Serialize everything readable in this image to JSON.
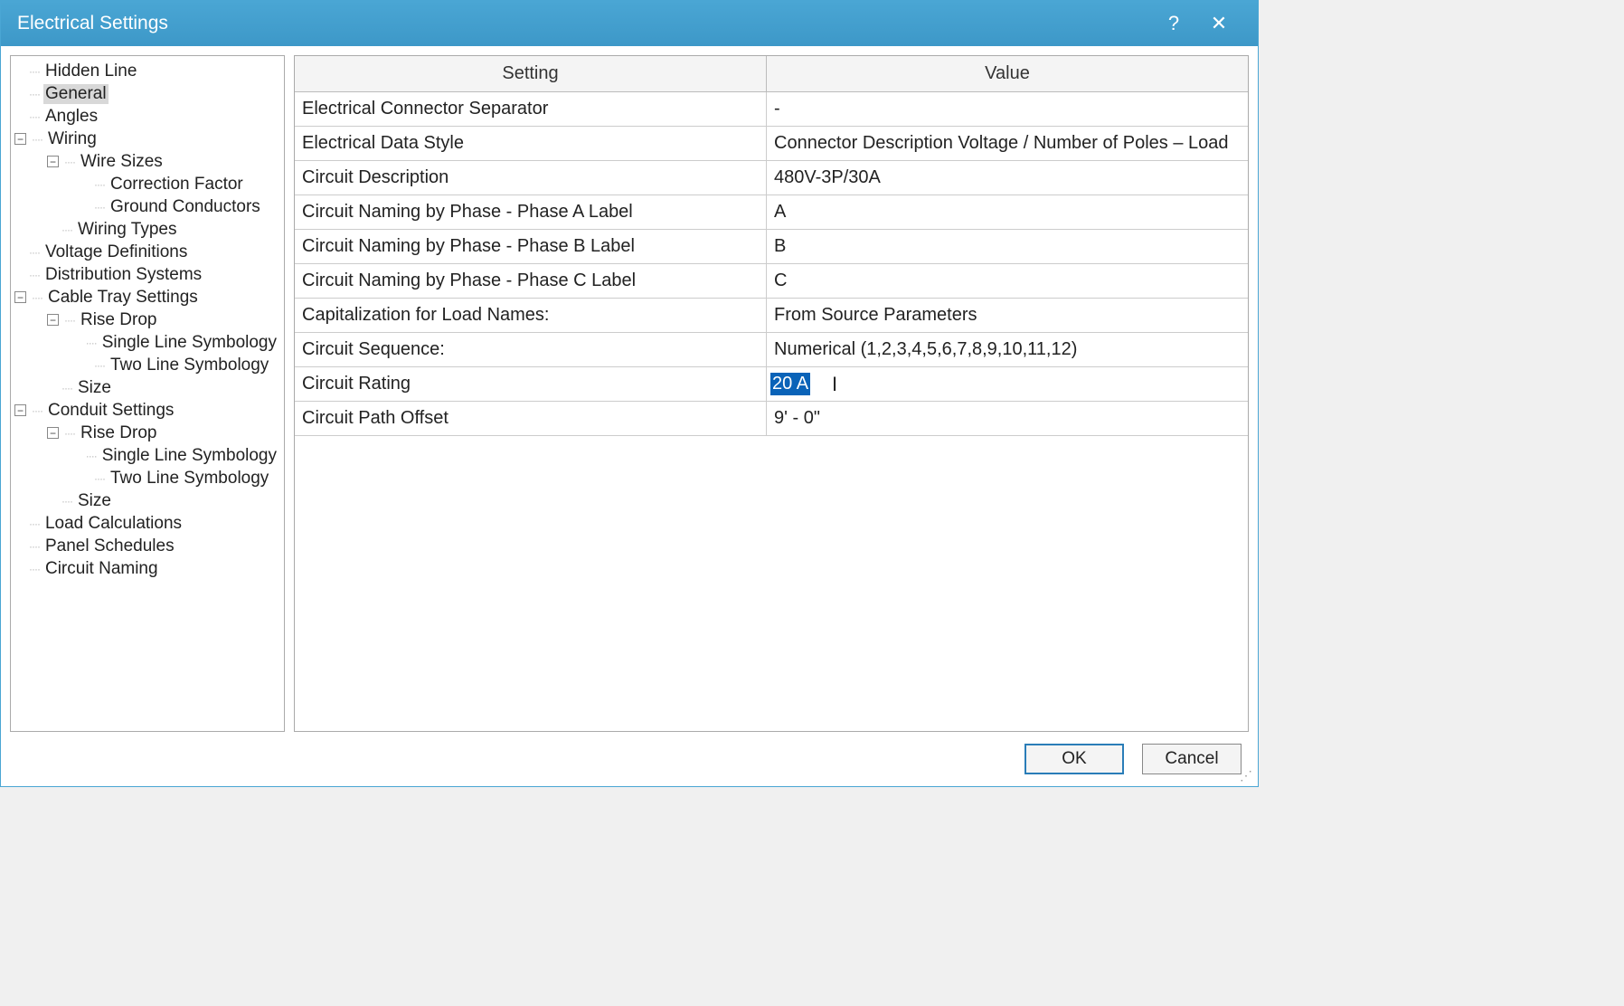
{
  "dialog": {
    "title": "Electrical Settings"
  },
  "tree": {
    "items": [
      {
        "label": "Hidden Line",
        "depth": 1,
        "toggle": null
      },
      {
        "label": "General",
        "depth": 1,
        "toggle": null,
        "selected": true
      },
      {
        "label": "Angles",
        "depth": 1,
        "toggle": null
      },
      {
        "label": "Wiring",
        "depth": 1,
        "toggle": "-"
      },
      {
        "label": "Wire Sizes",
        "depth": 2,
        "toggle": "-"
      },
      {
        "label": "Correction Factor",
        "depth": 3,
        "toggle": null
      },
      {
        "label": "Ground Conductors",
        "depth": 3,
        "toggle": null
      },
      {
        "label": "Wiring Types",
        "depth": 2,
        "toggle": null
      },
      {
        "label": "Voltage Definitions",
        "depth": 1,
        "toggle": null
      },
      {
        "label": "Distribution Systems",
        "depth": 1,
        "toggle": null
      },
      {
        "label": "Cable Tray Settings",
        "depth": 1,
        "toggle": "-"
      },
      {
        "label": "Rise Drop",
        "depth": 2,
        "toggle": "-"
      },
      {
        "label": "Single Line Symbology",
        "depth": 3,
        "toggle": null
      },
      {
        "label": "Two Line Symbology",
        "depth": 3,
        "toggle": null
      },
      {
        "label": "Size",
        "depth": 2,
        "toggle": null
      },
      {
        "label": "Conduit Settings",
        "depth": 1,
        "toggle": "-"
      },
      {
        "label": "Rise Drop",
        "depth": 2,
        "toggle": "-"
      },
      {
        "label": "Single Line Symbology",
        "depth": 3,
        "toggle": null
      },
      {
        "label": "Two Line Symbology",
        "depth": 3,
        "toggle": null
      },
      {
        "label": "Size",
        "depth": 2,
        "toggle": null
      },
      {
        "label": "Load Calculations",
        "depth": 1,
        "toggle": null
      },
      {
        "label": "Panel Schedules",
        "depth": 1,
        "toggle": null
      },
      {
        "label": "Circuit Naming",
        "depth": 1,
        "toggle": null
      }
    ]
  },
  "grid": {
    "headers": {
      "setting": "Setting",
      "value": "Value"
    },
    "rows": [
      {
        "setting": "Electrical Connector Separator",
        "value": "-"
      },
      {
        "setting": "Electrical Data Style",
        "value": "Connector Description Voltage / Number of Poles – Load"
      },
      {
        "setting": "Circuit Description",
        "value": "480V-3P/30A"
      },
      {
        "setting": "Circuit Naming by Phase - Phase A Label",
        "value": "A"
      },
      {
        "setting": "Circuit Naming by Phase - Phase B Label",
        "value": "B"
      },
      {
        "setting": "Circuit Naming by Phase - Phase C Label",
        "value": "C"
      },
      {
        "setting": "Capitalization for Load Names:",
        "value": "From Source Parameters"
      },
      {
        "setting": "Circuit Sequence:",
        "value": "Numerical (1,2,3,4,5,6,7,8,9,10,11,12)"
      },
      {
        "setting": "Circuit Rating",
        "value": "20 A",
        "editing": true
      },
      {
        "setting": "Circuit Path Offset",
        "value": "9' - 0\""
      }
    ]
  },
  "footer": {
    "ok": "OK",
    "cancel": "Cancel"
  }
}
